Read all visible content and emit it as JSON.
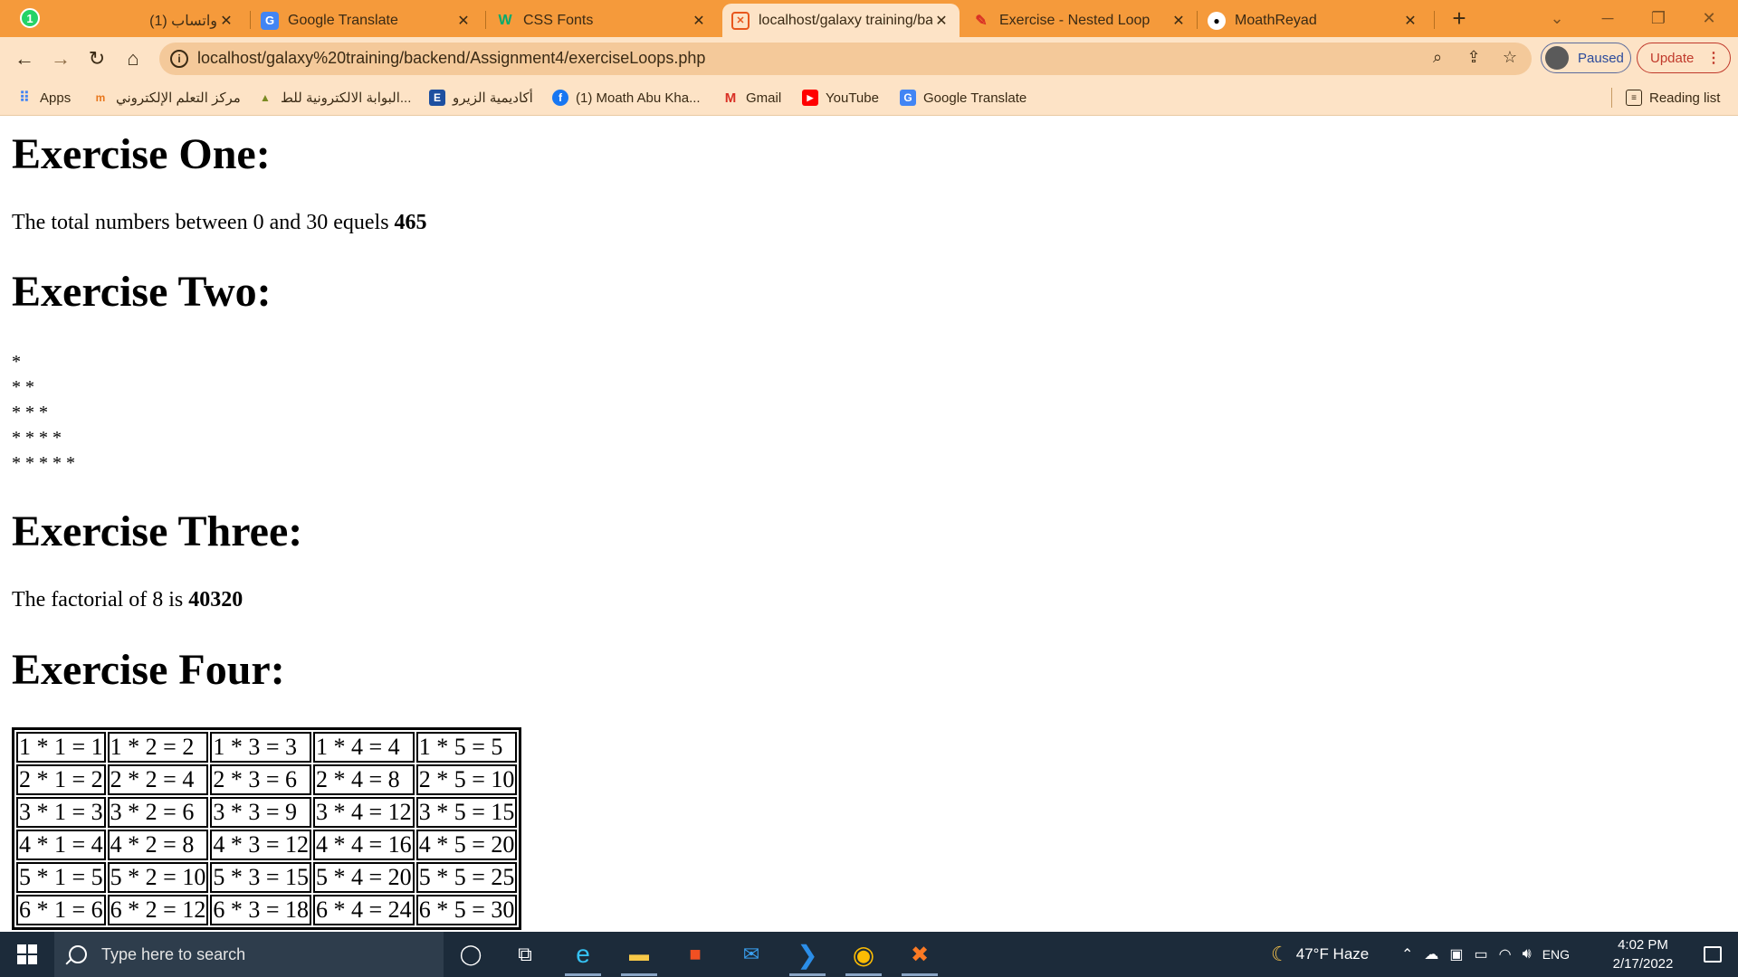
{
  "browser": {
    "tabs": [
      {
        "title": "(1) واتساب",
        "icon": "whatsapp-icon",
        "badge": "1"
      },
      {
        "title": "Google Translate",
        "icon": "google-translate-icon"
      },
      {
        "title": "CSS Fonts",
        "icon": "w3schools-icon"
      },
      {
        "title": "localhost/galaxy training/ba",
        "icon": "xampp-icon",
        "active": true
      },
      {
        "title": "Exercise - Nested Loop",
        "icon": "brush-icon"
      },
      {
        "title": "MoathReyad",
        "icon": "github-icon"
      }
    ],
    "new_tab": "+",
    "url": "localhost/galaxy%20training/backend/Assignment4/exerciseLoops.php",
    "profile_label": "Paused",
    "update_label": "Update",
    "bookmarks": [
      {
        "label": "Apps",
        "icon": "apps-grid-icon"
      },
      {
        "label": "مركز التعلم الإلكتروني",
        "icon": "moodle-icon"
      },
      {
        "label": "البوابة الالكترونية للط...",
        "icon": "university-icon"
      },
      {
        "label": "أكاديمية الزيرو",
        "icon": "zero-academy-icon"
      },
      {
        "label": "(1) Moath Abu Kha...",
        "icon": "facebook-icon"
      },
      {
        "label": "Gmail",
        "icon": "gmail-icon"
      },
      {
        "label": "YouTube",
        "icon": "youtube-icon"
      },
      {
        "label": "Google Translate",
        "icon": "google-translate-icon"
      }
    ],
    "reading_list": "Reading list"
  },
  "page": {
    "ex1": {
      "heading": "Exercise One:",
      "text": "The total numbers between 0 and 30 equels ",
      "value": "465"
    },
    "ex2": {
      "heading": "Exercise Two:",
      "stars": [
        "*",
        "* *",
        "* * *",
        "* * * *",
        "* * * * *"
      ]
    },
    "ex3": {
      "heading": "Exercise Three:",
      "text": "The factorial of 8 is ",
      "value": "40320"
    },
    "ex4": {
      "heading": "Exercise Four:",
      "table": [
        [
          "1 * 1 = 1",
          "1 * 2 = 2",
          "1 * 3 = 3",
          "1 * 4 = 4",
          "1 * 5 = 5"
        ],
        [
          "2 * 1 = 2",
          "2 * 2 = 4",
          "2 * 3 = 6",
          "2 * 4 = 8",
          "2 * 5 = 10"
        ],
        [
          "3 * 1 = 3",
          "3 * 2 = 6",
          "3 * 3 = 9",
          "3 * 4 = 12",
          "3 * 5 = 15"
        ],
        [
          "4 * 1 = 4",
          "4 * 2 = 8",
          "4 * 3 = 12",
          "4 * 4 = 16",
          "4 * 5 = 20"
        ],
        [
          "5 * 1 = 5",
          "5 * 2 = 10",
          "5 * 3 = 15",
          "5 * 4 = 20",
          "5 * 5 = 25"
        ],
        [
          "6 * 1 = 6",
          "6 * 2 = 12",
          "6 * 3 = 18",
          "6 * 4 = 24",
          "6 * 5 = 30"
        ]
      ]
    }
  },
  "taskbar": {
    "search_placeholder": "Type here to search",
    "weather": "47°F  Haze",
    "language": "ENG",
    "time": "4:02 PM",
    "date": "2/17/2022"
  },
  "colors": {
    "tabbar": "#f59a3b",
    "toolbar": "#fde3c6",
    "taskbar": "#1c2b3a"
  }
}
